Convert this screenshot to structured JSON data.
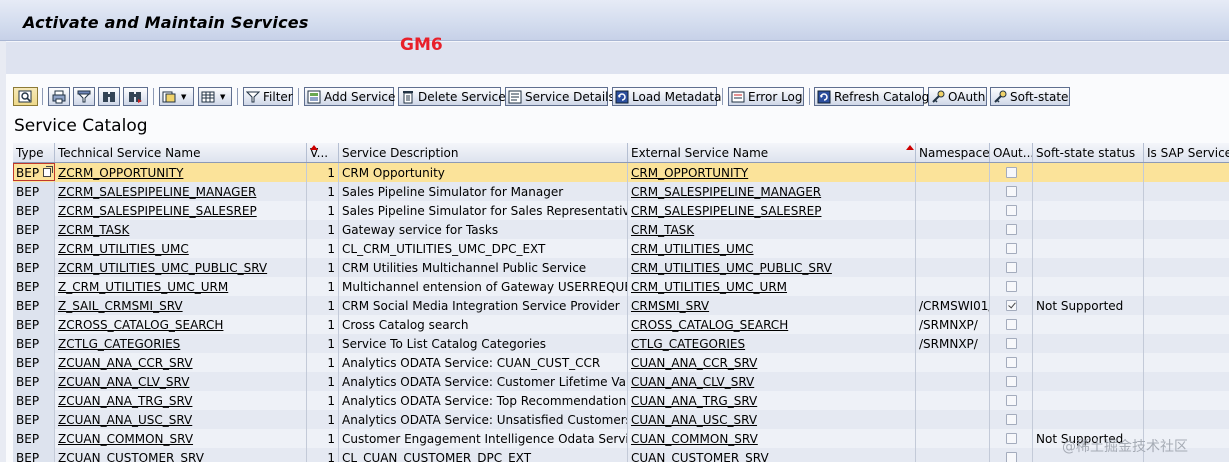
{
  "window": {
    "title": "Activate and Maintain Services"
  },
  "overlay_label": "GM6",
  "toolbar": {
    "filter": "Filter",
    "add_service": "Add Service",
    "delete_service": "Delete Service",
    "service_details": "Service Details",
    "load_metadata": "Load Metadata",
    "error_log": "Error Log",
    "refresh_catalog": "Refresh Catalog",
    "oauth": "OAuth",
    "soft_state": "Soft-state",
    "icons": [
      "details-icon",
      "print-icon",
      "filter-funnel-icon",
      "find-icon",
      "find-next-icon",
      "export-icon",
      "layout-icon"
    ]
  },
  "catalog": {
    "title": "Service Catalog"
  },
  "table": {
    "columns": {
      "type": "Type",
      "tech": "Technical Service Name",
      "version": "V...",
      "desc": "Service Description",
      "ext": "External Service Name",
      "ns": "Namespace",
      "oauth": "OAut...",
      "soft": "Soft-state status",
      "sap": "Is SAP Service"
    },
    "rows": [
      {
        "type": "BEP",
        "tech": "ZCRM_OPPORTUNITY",
        "version": "1",
        "desc": "CRM Opportunity",
        "ext": "CRM_OPPORTUNITY",
        "ns": "",
        "oauth": false,
        "soft": "",
        "sap": ""
      },
      {
        "type": "BEP",
        "tech": "ZCRM_SALESPIPELINE_MANAGER",
        "version": "1",
        "desc": "Sales Pipeline Simulator for Manager",
        "ext": "CRM_SALESPIPELINE_MANAGER",
        "ns": "",
        "oauth": false,
        "soft": "",
        "sap": ""
      },
      {
        "type": "BEP",
        "tech": "ZCRM_SALESPIPELINE_SALESREP",
        "version": "1",
        "desc": "Sales Pipeline Simulator for Sales Representative",
        "ext": "CRM_SALESPIPELINE_SALESREP",
        "ns": "",
        "oauth": false,
        "soft": "",
        "sap": ""
      },
      {
        "type": "BEP",
        "tech": "ZCRM_TASK",
        "version": "1",
        "desc": "Gateway service for Tasks",
        "ext": "CRM_TASK",
        "ns": "",
        "oauth": false,
        "soft": "",
        "sap": ""
      },
      {
        "type": "BEP",
        "tech": "ZCRM_UTILITIES_UMC",
        "version": "1",
        "desc": "CL_CRM_UTILITIES_UMC_DPC_EXT",
        "ext": "CRM_UTILITIES_UMC",
        "ns": "",
        "oauth": false,
        "soft": "",
        "sap": ""
      },
      {
        "type": "BEP",
        "tech": "ZCRM_UTILITIES_UMC_PUBLIC_SRV",
        "version": "1",
        "desc": "CRM Utilities Multichannel Public Service",
        "ext": "CRM_UTILITIES_UMC_PUBLIC_SRV",
        "ns": "",
        "oauth": false,
        "soft": "",
        "sap": ""
      },
      {
        "type": "BEP",
        "tech": "Z_CRM_UTILITIES_UMC_URM",
        "version": "1",
        "desc": "Multichannel entension of Gateway USERREQUES...",
        "ext": "CRM_UTILITIES_UMC_URM",
        "ns": "",
        "oauth": false,
        "soft": "",
        "sap": ""
      },
      {
        "type": "BEP",
        "tech": "Z_SAIL_CRMSMI_SRV",
        "version": "1",
        "desc": "CRM Social Media Integration Service Provider",
        "ext": "CRMSMI_SRV",
        "ns": "/CRMSWI01/",
        "oauth": true,
        "soft": "Not Supported",
        "sap": ""
      },
      {
        "type": "BEP",
        "tech": "ZCROSS_CATALOG_SEARCH",
        "version": "1",
        "desc": "Cross Catalog search",
        "ext": "CROSS_CATALOG_SEARCH",
        "ns": "/SRMNXP/",
        "oauth": false,
        "soft": "",
        "sap": ""
      },
      {
        "type": "BEP",
        "tech": "ZCTLG_CATEGORIES",
        "version": "1",
        "desc": "Service To List Catalog Categories",
        "ext": "CTLG_CATEGORIES",
        "ns": "/SRMNXP/",
        "oauth": false,
        "soft": "",
        "sap": ""
      },
      {
        "type": "BEP",
        "tech": "ZCUAN_ANA_CCR_SRV",
        "version": "1",
        "desc": "Analytics ODATA Service: CUAN_CUST_CCR",
        "ext": "CUAN_ANA_CCR_SRV",
        "ns": "",
        "oauth": false,
        "soft": "",
        "sap": ""
      },
      {
        "type": "BEP",
        "tech": "ZCUAN_ANA_CLV_SRV",
        "version": "1",
        "desc": "Analytics ODATA Service: Customer Lifetime Value",
        "ext": "CUAN_ANA_CLV_SRV",
        "ns": "",
        "oauth": false,
        "soft": "",
        "sap": ""
      },
      {
        "type": "BEP",
        "tech": "ZCUAN_ANA_TRG_SRV",
        "version": "1",
        "desc": "Analytics ODATA Service: Top Recommendations",
        "ext": "CUAN_ANA_TRG_SRV",
        "ns": "",
        "oauth": false,
        "soft": "",
        "sap": ""
      },
      {
        "type": "BEP",
        "tech": "ZCUAN_ANA_USC_SRV",
        "version": "1",
        "desc": "Analytics ODATA Service: Unsatisfied Customers",
        "ext": "CUAN_ANA_USC_SRV",
        "ns": "",
        "oauth": false,
        "soft": "",
        "sap": ""
      },
      {
        "type": "BEP",
        "tech": "ZCUAN_COMMON_SRV",
        "version": "1",
        "desc": "Customer Engagement Intelligence Odata Service",
        "ext": "CUAN_COMMON_SRV",
        "ns": "",
        "oauth": false,
        "soft": "Not Supported",
        "sap": ""
      },
      {
        "type": "BEP",
        "tech": "ZCUAN_CUSTOMER_SRV",
        "version": "1",
        "desc": "CL_CUAN_CUSTOMER_DPC_EXT",
        "ext": "CUAN_CUSTOMER_SRV",
        "ns": "",
        "oauth": false,
        "soft": "",
        "sap": ""
      }
    ]
  },
  "watermark": "@稀土掘金技术社区",
  "colors": {
    "accent_red": "#e8202a",
    "selected_row": "#fbe39a",
    "header_blue": "#d3dcee"
  }
}
